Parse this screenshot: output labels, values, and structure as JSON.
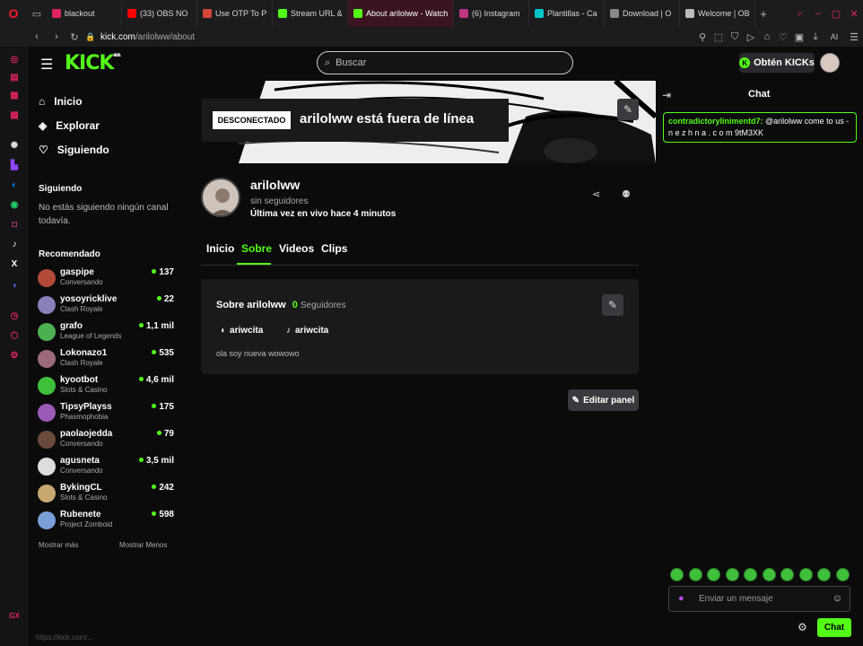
{
  "browser": {
    "tabs": [
      {
        "label": "blackout",
        "color": "#e0245e"
      },
      {
        "label": "(33) OBS NO",
        "color": "#ff0000"
      },
      {
        "label": "Use OTP To P",
        "color": "#d44638"
      },
      {
        "label": "Stream URL &",
        "color": "#53fc18"
      },
      {
        "label": "About arilolww - Watch",
        "color": "#53fc18"
      },
      {
        "label": "(6) Instagram",
        "color": "#c13584"
      },
      {
        "label": "Plantillas - Ca",
        "color": "#00c4cc"
      },
      {
        "label": "Download | O",
        "color": "#888888"
      },
      {
        "label": "Welcome | OB",
        "color": "#bbbbbb"
      }
    ],
    "url_host": "kick.com",
    "url_path": "/arilolww/about",
    "ai_label": "AI",
    "status_text": "https://kick.com/..."
  },
  "header": {
    "logo": "KICK",
    "logo_beta": "BETA",
    "search_placeholder": "Buscar",
    "get_kicks": "Obtén KICKs"
  },
  "nav": {
    "items": [
      "Inicio",
      "Explorar",
      "Siguiendo"
    ],
    "following_heading": "Siguiendo",
    "following_empty": "No estás siguiendo ningún canal todavía.",
    "recommended_heading": "Recomendado",
    "recommended": [
      {
        "name": "gaspipe",
        "category": "Conversando",
        "viewers": "137",
        "color": "#b24a3a"
      },
      {
        "name": "yosoyricklive",
        "category": "Clash Royale",
        "viewers": "22",
        "color": "#8a7fb8"
      },
      {
        "name": "grafo",
        "category": "League of Legends",
        "viewers": "1,1 mil",
        "color": "#4caf50"
      },
      {
        "name": "Lokonazo1",
        "category": "Clash Royale",
        "viewers": "535",
        "color": "#9c6a7a"
      },
      {
        "name": "kyootbot",
        "category": "Slots & Casino",
        "viewers": "4,6 mil",
        "color": "#3fbf3a"
      },
      {
        "name": "TipsyPlayss",
        "category": "Phasmophobia",
        "viewers": "175",
        "color": "#9b59b6"
      },
      {
        "name": "paolaojedda",
        "category": "Conversando",
        "viewers": "79",
        "color": "#6a4a3a"
      },
      {
        "name": "agusneta",
        "category": "Conversando",
        "viewers": "3,5 mil",
        "color": "#dddddd"
      },
      {
        "name": "BykingCL",
        "category": "Slots & Casino",
        "viewers": "242",
        "color": "#c8a870"
      },
      {
        "name": "Rubenete",
        "category": "Project Zomboid",
        "viewers": "598",
        "color": "#7aa0d8"
      }
    ],
    "show_more": "Mostrar más",
    "show_less": "Mostrar Menos"
  },
  "channel": {
    "offline_badge": "DESCONECTADO",
    "offline_title": "arilolww está fuera de línea",
    "name": "arilolww",
    "followers_text": "sin seguidores",
    "last_live": "Última vez en vivo hace 4 minutos",
    "tabs": [
      "Inicio",
      "Sobre",
      "Videos",
      "Clips"
    ],
    "active_tab": "Sobre"
  },
  "about": {
    "title": "Sobre arilolww",
    "followers_count": "0",
    "followers_label": "Seguidores",
    "socials": [
      {
        "icon": "discord-icon",
        "handle": "ariwcita"
      },
      {
        "icon": "tiktok-icon",
        "handle": "ariwcita"
      }
    ],
    "bio": "ola soy nueva wowowo",
    "edit_panel": "Editar panel"
  },
  "chat": {
    "title": "Chat",
    "message_user": "contradictorylinimentd7:",
    "message_text": "@arilolww come to us - n e z h n a . c o m 9tM3XK",
    "input_placeholder": "Enviar un mensaje",
    "send_label": "Chat"
  },
  "colors": {
    "accent": "#53fc18",
    "bg": "#0b0b0c",
    "panel": "#1a1a1d"
  }
}
